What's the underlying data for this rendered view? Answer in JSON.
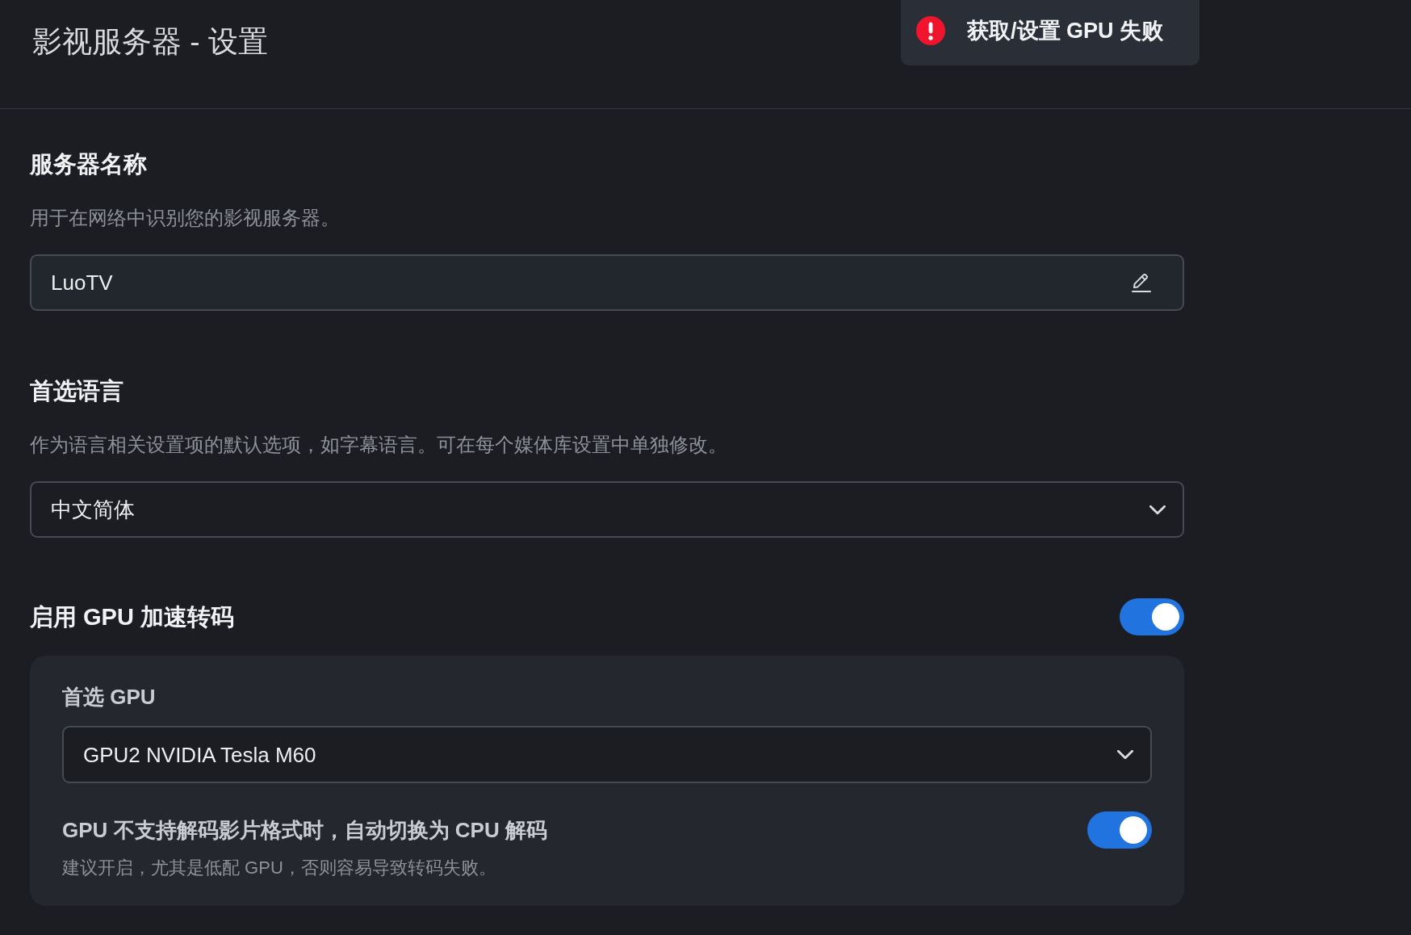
{
  "header": {
    "title": "影视服务器 - 设置"
  },
  "toast": {
    "kind": "error",
    "message": "获取/设置 GPU 失败"
  },
  "sections": [
    {
      "kind": "text_field",
      "title": "服务器名称",
      "description": "用于在网络中识别您的影视服务器。",
      "value": "LuoTV"
    },
    {
      "kind": "select",
      "title": "首选语言",
      "description": "作为语言相关设置项的默认选项，如字幕语言。可在每个媒体库设置中单独修改。",
      "value": "中文简体"
    },
    {
      "kind": "toggle",
      "title": "启用 GPU 加速转码",
      "on": true,
      "panel": {
        "select": {
          "label": "首选 GPU",
          "value": "GPU2 NVIDIA Tesla M60"
        },
        "option": {
          "label": "GPU 不支持解码影片格式时，自动切换为 CPU 解码",
          "hint": "建议开启，尤其是低配 GPU，否则容易导致转码失败。",
          "on": true
        }
      }
    }
  ]
}
